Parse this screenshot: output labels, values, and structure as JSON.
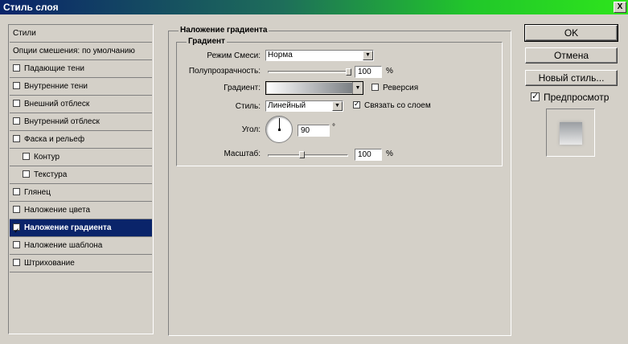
{
  "window": {
    "title": "Стиль слоя",
    "close_label": "X"
  },
  "styles_list": [
    {
      "label": "Стили",
      "checkbox": false,
      "checked": false,
      "indent": false,
      "selected": false
    },
    {
      "label": "Опции смешения: по умолчанию",
      "checkbox": false,
      "checked": false,
      "indent": false,
      "selected": false
    },
    {
      "label": "Падающие тени",
      "checkbox": true,
      "checked": false,
      "indent": false,
      "selected": false
    },
    {
      "label": "Внутренние тени",
      "checkbox": true,
      "checked": false,
      "indent": false,
      "selected": false
    },
    {
      "label": "Внешний отблеск",
      "checkbox": true,
      "checked": false,
      "indent": false,
      "selected": false
    },
    {
      "label": "Внутренний отблеск",
      "checkbox": true,
      "checked": false,
      "indent": false,
      "selected": false
    },
    {
      "label": "Фаска и рельеф",
      "checkbox": true,
      "checked": false,
      "indent": false,
      "selected": false
    },
    {
      "label": "Контур",
      "checkbox": true,
      "checked": false,
      "indent": true,
      "selected": false
    },
    {
      "label": "Текстура",
      "checkbox": true,
      "checked": false,
      "indent": true,
      "selected": false
    },
    {
      "label": "Глянец",
      "checkbox": true,
      "checked": false,
      "indent": false,
      "selected": false
    },
    {
      "label": "Наложение цвета",
      "checkbox": true,
      "checked": false,
      "indent": false,
      "selected": false
    },
    {
      "label": "Наложение градиента",
      "checkbox": true,
      "checked": true,
      "indent": false,
      "selected": true
    },
    {
      "label": "Наложение шаблона",
      "checkbox": true,
      "checked": false,
      "indent": false,
      "selected": false
    },
    {
      "label": "Штрихование",
      "checkbox": true,
      "checked": false,
      "indent": false,
      "selected": false
    }
  ],
  "panel": {
    "title": "Наложение градиента",
    "group_title": "Градиент",
    "blend_mode": {
      "label": "Режим Смеси:",
      "value": "Норма"
    },
    "opacity": {
      "label": "Полупрозрачность:",
      "value": "100",
      "unit": "%",
      "level": 1.0
    },
    "gradient": {
      "label": "Градиент:",
      "reverse_label": "Реверсия",
      "reverse_checked": false
    },
    "style": {
      "label": "Стиль:",
      "value": "Линейный",
      "align_label": "Связать со слоем",
      "align_checked": true
    },
    "angle": {
      "label": "Угол:",
      "value": "90",
      "unit": "°",
      "degrees": 90
    },
    "scale": {
      "label": "Масштаб:",
      "value": "100",
      "unit": "%",
      "level": 0.41
    }
  },
  "buttons": {
    "ok": "OK",
    "cancel": "Отмена",
    "new_style": "Новый стиль...",
    "preview_label": "Предпросмотр",
    "preview_checked": true
  },
  "colors": {
    "title_start": "#0a246a",
    "title_end": "#2ee51c",
    "selected_bg": "#0a246a",
    "face": "#d4d0c8"
  }
}
